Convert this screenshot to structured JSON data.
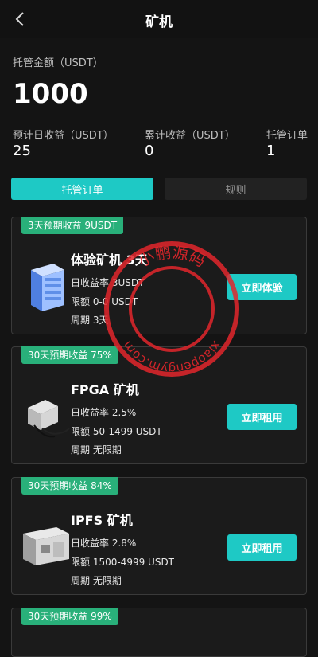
{
  "header": {
    "title": "矿机"
  },
  "summary": {
    "total_label": "托管金额（USDT）",
    "total_value": "1000",
    "stats": [
      {
        "label": "预计日收益（USDT）",
        "value": "25"
      },
      {
        "label": "累计收益（USDT）",
        "value": "0"
      },
      {
        "label": "托管订单",
        "value": "1"
      }
    ]
  },
  "tabs": [
    {
      "label": "托管订单",
      "active": true
    },
    {
      "label": "规则",
      "active": false
    }
  ],
  "cards": [
    {
      "badge": "3天预期收益 9USDT",
      "name": "体验矿机 3天",
      "rate": "日收益率 3USDT",
      "limit": "限额 0-0 USDT",
      "period": "周期 3天",
      "cta": "立即体验"
    },
    {
      "badge": "30天预期收益 75%",
      "name": "FPGA 矿机",
      "rate": "日收益率 2.5%",
      "limit": "限额 50-1499 USDT",
      "period": "周期 无限期",
      "cta": "立即租用"
    },
    {
      "badge": "30天预期收益 84%",
      "name": "IPFS 矿机",
      "rate": "日收益率 2.8%",
      "limit": "限额 1500-4999 USDT",
      "period": "周期 无限期",
      "cta": "立即租用"
    },
    {
      "badge": "30天预期收益 99%"
    }
  ],
  "watermark": {
    "text_top": "小鹏源码",
    "text_bottom": "xiaopengym.com",
    "color": "#e2262b"
  },
  "colors": {
    "accent": "#1ec9c5",
    "badge": "#29b07a",
    "background": "#141414"
  }
}
